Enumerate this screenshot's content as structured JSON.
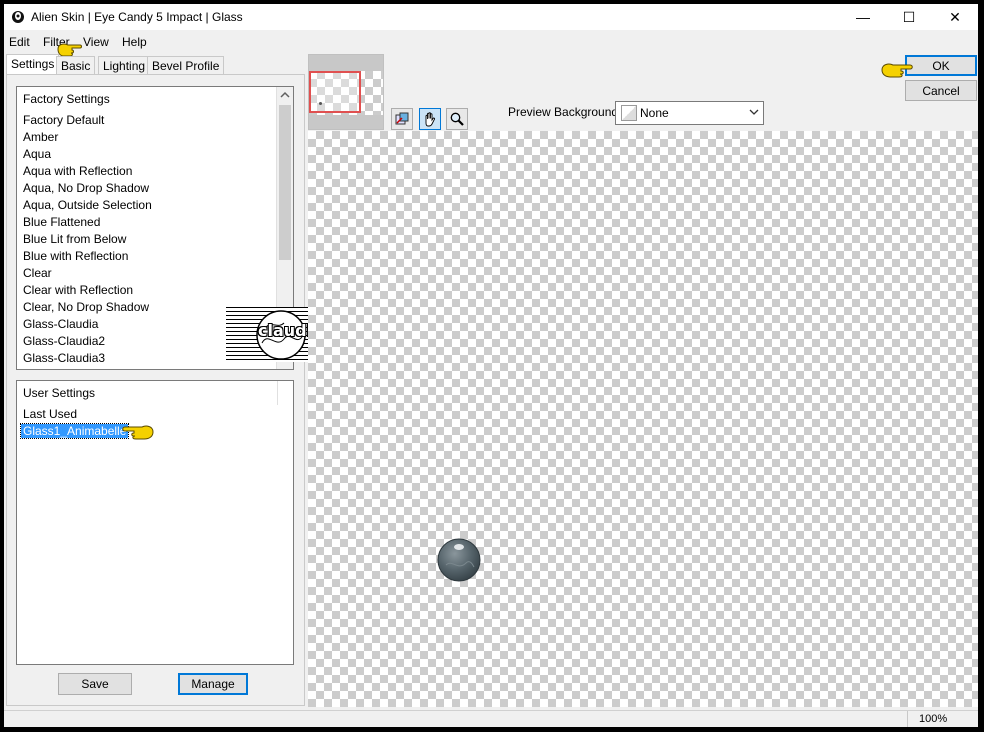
{
  "window": {
    "title": "Alien Skin | Eye Candy 5 Impact | Glass",
    "minimize_symbol": "—",
    "maximize_symbol": "☐",
    "close_symbol": "✕"
  },
  "menu": [
    "Edit",
    "Filter",
    "View",
    "Help"
  ],
  "tabs": [
    "Settings",
    "Basic",
    "Lighting",
    "Bevel Profile"
  ],
  "factory_settings": {
    "header": "Factory Settings",
    "items": [
      "Factory Default",
      "Amber",
      "Aqua",
      "Aqua with Reflection",
      "Aqua, No Drop Shadow",
      "Aqua, Outside Selection",
      "Blue Flattened",
      "Blue Lit from Below",
      "Blue with Reflection",
      "Clear",
      "Clear with Reflection",
      "Clear, No Drop Shadow",
      "Glass-Claudia",
      "Glass-Claudia2",
      "Glass-Claudia3"
    ]
  },
  "user_settings": {
    "header": "User Settings",
    "items": [
      "Last Used",
      "Glass1_Animabelle"
    ],
    "selected_index": 1
  },
  "buttons": {
    "save": "Save",
    "manage": "Manage",
    "ok": "OK",
    "cancel": "Cancel"
  },
  "preview": {
    "background_label": "Preview Background:",
    "background_value": "None"
  },
  "watermark": {
    "text": "claudia"
  },
  "status": {
    "zoom": "100%"
  },
  "colors": {
    "selection": "#3399ff",
    "default_button_border": "#0078d7",
    "navigator_frame": "#e05050",
    "pointer_hand": "#f5d100"
  },
  "icons": {
    "app": "alien-skin-app-icon",
    "preview_tool": "preview-compare-icon",
    "hand_tool": "hand-icon",
    "zoom_tool": "magnifier-icon",
    "pointer": "pointing-hand-icon"
  }
}
